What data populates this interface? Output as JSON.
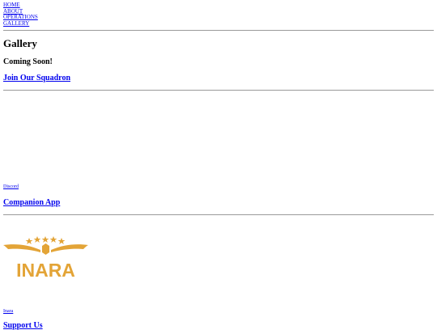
{
  "nav": {
    "items": [
      "HOME",
      "ABOUT",
      "OPERATIONS",
      "GALLERY"
    ]
  },
  "page": {
    "title": "Gallery",
    "subtitle": "Coming Soon!"
  },
  "sections": {
    "squadron": {
      "heading": "Join Our Squadron",
      "link": "Discord"
    },
    "companion": {
      "heading": "Companion App",
      "link": "Inara",
      "logo_text": "INARA"
    },
    "support": {
      "heading": "Support Us"
    }
  },
  "colors": {
    "link": "#0000ee",
    "logo_gold": "#e3a437",
    "rule": "#9a9a9a"
  }
}
